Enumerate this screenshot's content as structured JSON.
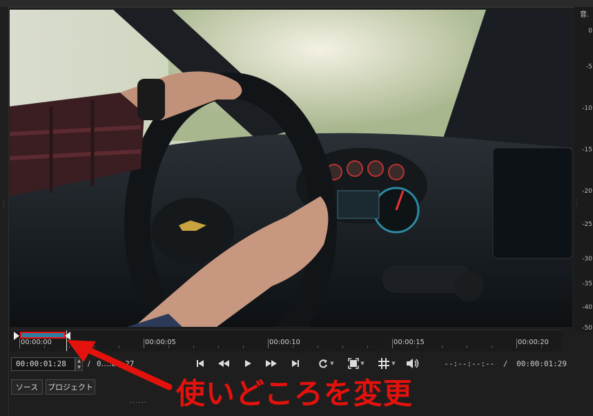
{
  "window": {
    "top_fragment": ""
  },
  "meter": {
    "header": "音.",
    "ticks": [
      "0",
      "-5",
      "-10",
      "-15",
      "-20",
      "-25",
      "-30",
      "-35",
      "-40",
      "-50"
    ]
  },
  "timeline": {
    "ruler_labels": [
      "00:00:00",
      "00:00:05",
      "00:00:10",
      "00:00:15",
      "00:00:20"
    ]
  },
  "transport": {
    "current_timecode": "00:00:01:28",
    "separator": "/",
    "duration": "00:00:01:27",
    "duration_visible": "0‥‥01:27",
    "right_in_out": "--:--:--:--",
    "right_separator": "/",
    "right_duration": "00:00:01:29"
  },
  "tabs": {
    "source": "ソース",
    "project": "プロジェクト"
  },
  "annotation": {
    "text": "使いどころを変更",
    "color": "#e3120c"
  },
  "icons": {
    "skip_start": "skip-to-start-icon",
    "rewind": "rewind-icon",
    "play": "play-icon",
    "fast_forward": "fast-forward-icon",
    "skip_end": "skip-to-end-icon",
    "loop": "loop-icon",
    "zoom": "zoom-fit-icon",
    "grid": "grid-icon",
    "volume": "volume-icon"
  }
}
